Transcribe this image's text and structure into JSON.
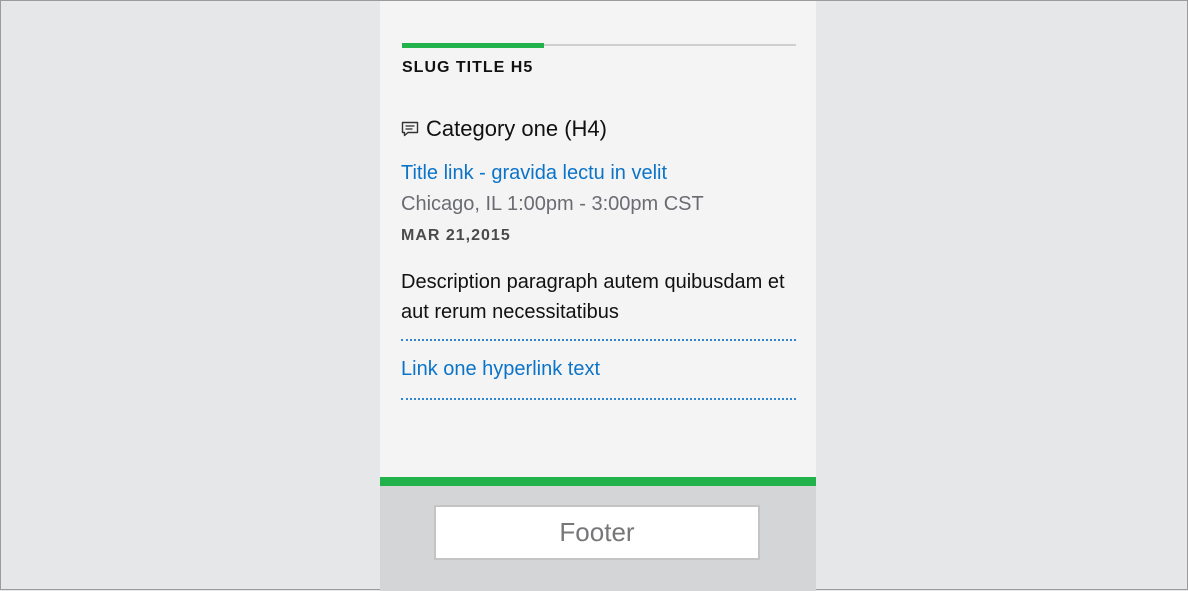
{
  "card": {
    "progress_percent": 36,
    "slug_title": "SLUG TITLE H5",
    "category_icon": "chat-bubble-icon",
    "category_title": "Category one (H4)",
    "title_link": "Title link - gravida lectu in velit",
    "location": "Chicago, IL 1:00pm - 3:00pm CST",
    "date": "MAR 21,2015",
    "description": "Description paragraph autem quibusdam et aut rerum necessitatibus",
    "link_one": "Link one hyperlink text"
  },
  "footer": {
    "label": "Footer"
  },
  "colors": {
    "accent_green": "#21b24b",
    "link_blue": "#0b74c8",
    "page_bg": "#e6e7e8",
    "card_bg": "#f4f4f4",
    "footer_bg": "#d4d5d7"
  }
}
